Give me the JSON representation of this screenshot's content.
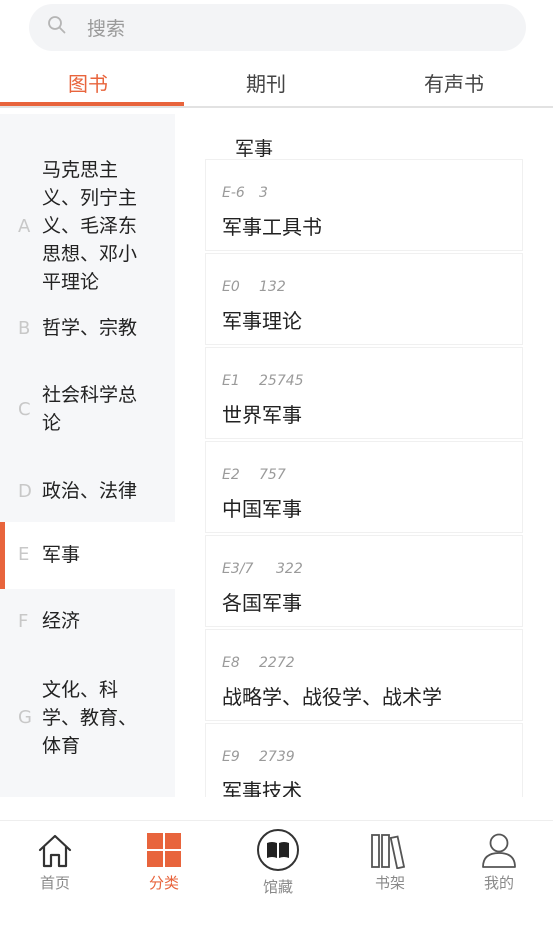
{
  "search": {
    "placeholder": "搜索"
  },
  "tabs": [
    {
      "label": "图书",
      "active": true
    },
    {
      "label": "期刊",
      "active": false
    },
    {
      "label": "有声书",
      "active": false
    }
  ],
  "sidebar": {
    "items": [
      {
        "letter": "A",
        "name": "马克思主义、列宁主义、毛泽东思想、邓小平理论"
      },
      {
        "letter": "B",
        "name": "哲学、宗教"
      },
      {
        "letter": "C",
        "name": "社会科学总论"
      },
      {
        "letter": "D",
        "name": "政治、法律"
      },
      {
        "letter": "E",
        "name": "军事",
        "active": true
      },
      {
        "letter": "F",
        "name": "经济"
      },
      {
        "letter": "G",
        "name": "文化、科学、教育、体育"
      }
    ]
  },
  "content": {
    "section_title": "军事",
    "items": [
      {
        "code": "E-6",
        "count": "3",
        "title": "军事工具书"
      },
      {
        "code": "E0",
        "count": "132",
        "title": "军事理论"
      },
      {
        "code": "E1",
        "count": "25745",
        "title": "世界军事"
      },
      {
        "code": "E2",
        "count": "757",
        "title": "中国军事"
      },
      {
        "code": "E3/7",
        "count": "322",
        "title": "各国军事"
      },
      {
        "code": "E8",
        "count": "2272",
        "title": "战略学、战役学、战术学"
      },
      {
        "code": "E9",
        "count": "2739",
        "title": "军事技术"
      }
    ]
  },
  "bottom_nav": {
    "items": [
      {
        "label": "首页",
        "icon": "home-icon"
      },
      {
        "label": "分类",
        "icon": "category-icon",
        "active": true
      },
      {
        "label": "馆藏",
        "icon": "collection-icon"
      },
      {
        "label": "书架",
        "icon": "bookshelf-icon"
      },
      {
        "label": "我的",
        "icon": "profile-icon"
      }
    ]
  },
  "colors": {
    "accent": "#e8643c",
    "sidebar_bg": "#f6f7f9",
    "muted": "#9a9a9a"
  }
}
